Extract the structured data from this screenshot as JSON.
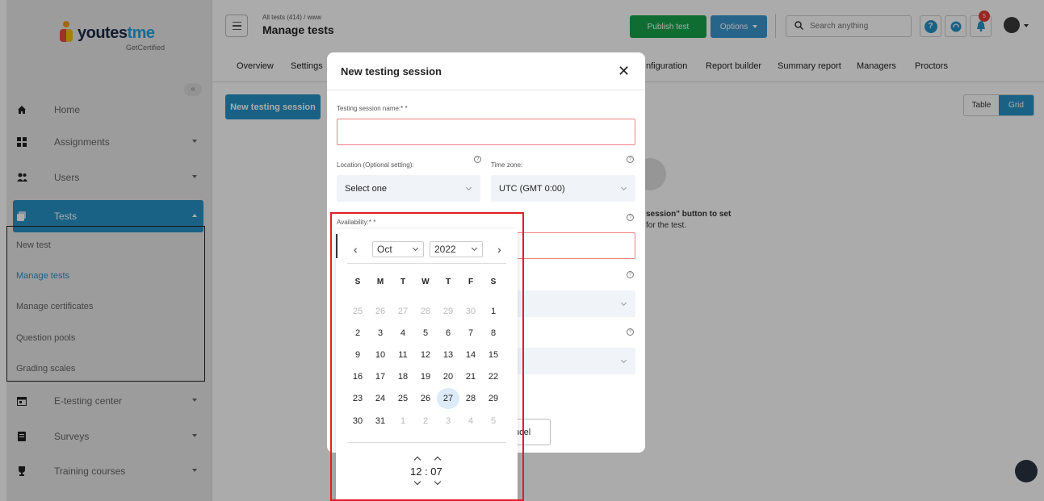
{
  "sidebar": {
    "logo": {
      "word_a": "youtes",
      "word_b": "tme",
      "sub": "GetCertified"
    },
    "collapse_icon": "«",
    "items": [
      {
        "label": "Home"
      },
      {
        "label": "Assignments"
      },
      {
        "label": "Users"
      },
      {
        "label": "Tests"
      },
      {
        "label": "E-testing center"
      },
      {
        "label": "Surveys"
      },
      {
        "label": "Training courses"
      }
    ],
    "submenu": [
      "New test",
      "Manage tests",
      "Manage certificates",
      "Question pools",
      "Grading scales"
    ]
  },
  "header": {
    "breadcrumb": "All tests (414)  /  www",
    "title": "Manage tests",
    "publish_label": "Publish test",
    "options_label": "Options",
    "search_placeholder": "Search anything",
    "notification_count": "5"
  },
  "tabs": [
    "Overview",
    "Settings",
    "nfiguration",
    "Report builder",
    "Summary report",
    "Managers",
    "Proctors"
  ],
  "content": {
    "new_session_label": "New testing session",
    "view_table": "Table",
    "view_grid": "Grid",
    "empty_line1": "session\" button to set",
    "empty_line2": "for the test."
  },
  "modal": {
    "title": "New testing session",
    "close": "✕",
    "name_label": "Testing session name:* *",
    "location_label": "Location (Optional setting):",
    "location_value": "Select one",
    "timezone_label": "Time zone:",
    "timezone_value": "UTC (GMT 0:00)",
    "availability_label": "Availability:* *",
    "cancel_label": "ncel"
  },
  "picker": {
    "prev": "‹",
    "next": "›",
    "month": "Oct",
    "year": "2022",
    "weekdays": [
      "S",
      "M",
      "T",
      "W",
      "T",
      "F",
      "S"
    ],
    "weeks": [
      [
        "25",
        "26",
        "27",
        "28",
        "29",
        "30",
        "1"
      ],
      [
        "2",
        "3",
        "4",
        "5",
        "6",
        "7",
        "8"
      ],
      [
        "9",
        "10",
        "11",
        "12",
        "13",
        "14",
        "15"
      ],
      [
        "16",
        "17",
        "18",
        "19",
        "20",
        "21",
        "22"
      ],
      [
        "23",
        "24",
        "25",
        "26",
        "27",
        "28",
        "29"
      ],
      [
        "30",
        "31",
        "1",
        "2",
        "3",
        "4",
        "5"
      ]
    ],
    "selected_day": "27",
    "time": "12 : 07"
  }
}
